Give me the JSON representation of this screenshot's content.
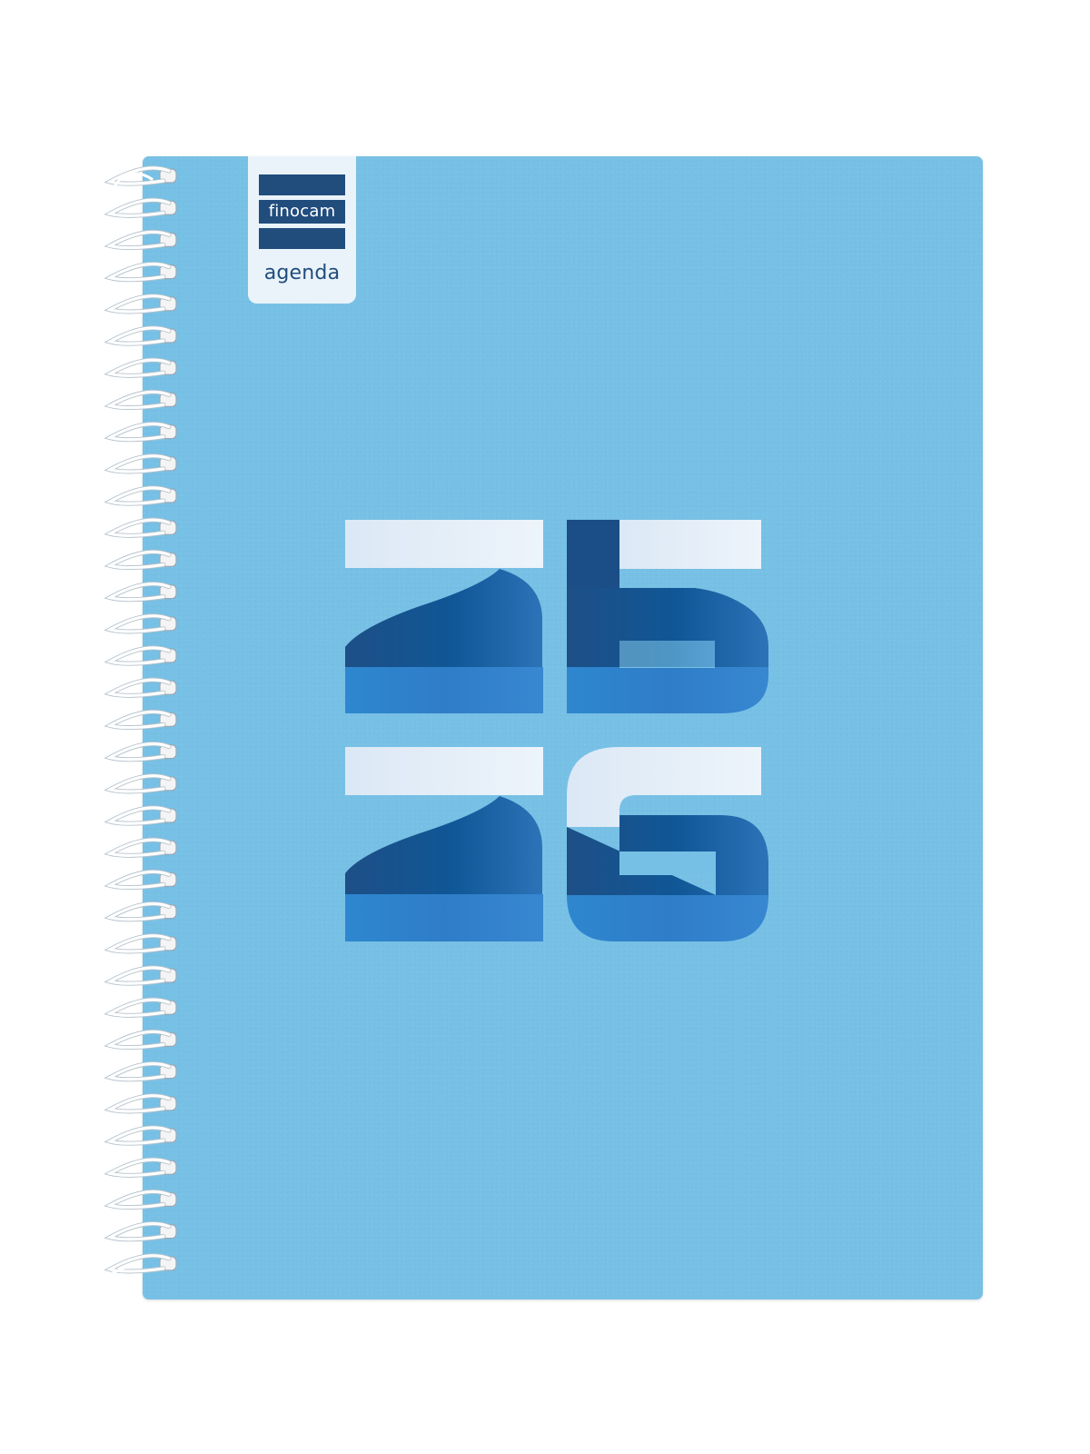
{
  "logo": {
    "brand": "finocam",
    "word": "agenda"
  },
  "cover": {
    "year_lines": [
      "25",
      "26"
    ],
    "cover_color": "#77c0e5",
    "logo_panel_color": "#eaf3fa",
    "logo_ink_color": "#214d7d"
  }
}
